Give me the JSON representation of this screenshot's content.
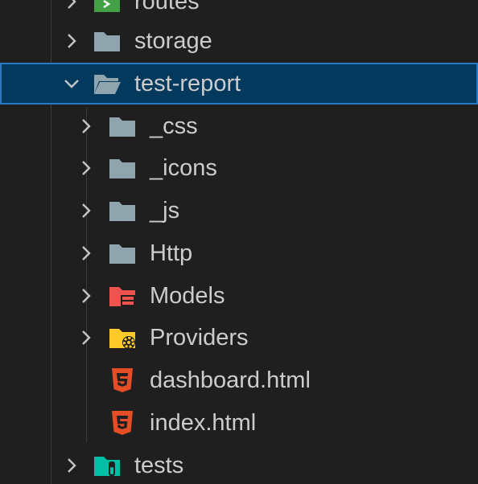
{
  "tree": {
    "routes": {
      "label": "routes"
    },
    "storage": {
      "label": "storage"
    },
    "test_report": {
      "label": "test-report"
    },
    "css": {
      "label": "_css"
    },
    "icons": {
      "label": "_icons"
    },
    "js": {
      "label": "_js"
    },
    "http": {
      "label": "Http"
    },
    "models": {
      "label": "Models"
    },
    "providers": {
      "label": "Providers"
    },
    "dashboard": {
      "label": "dashboard.html"
    },
    "index": {
      "label": "index.html"
    },
    "tests": {
      "label": "tests"
    }
  },
  "colors": {
    "selection_bg": "#04395e",
    "selection_border": "#2b79c2",
    "folder_gray": "#90a4ae",
    "models_red": "#ef5350",
    "providers_yellow": "#ffca28",
    "html_orange": "#e44d26",
    "tests_teal": "#00bfa5",
    "routes_green": "#43a047"
  }
}
